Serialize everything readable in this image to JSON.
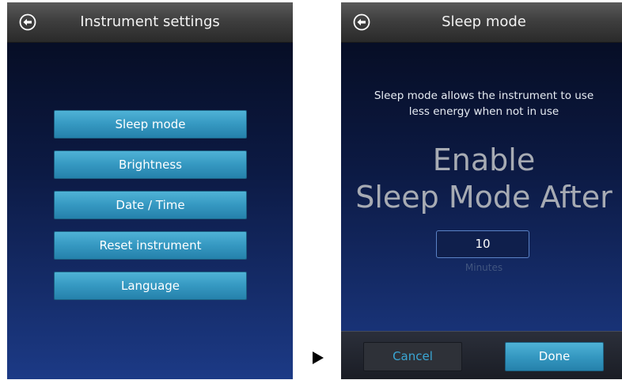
{
  "instrument_settings": {
    "title": "Instrument settings",
    "back_icon": "back-arrow-circle-icon",
    "menu": [
      {
        "label": "Sleep mode"
      },
      {
        "label": "Brightness"
      },
      {
        "label": "Date / Time"
      },
      {
        "label": "Reset instrument"
      },
      {
        "label": "Language"
      }
    ]
  },
  "transition_icon": "right-triangle-arrow-icon",
  "sleep_mode": {
    "title": "Sleep mode",
    "back_icon": "back-arrow-circle-icon",
    "description_line1": "Sleep mode allows the instrument to use",
    "description_line2": "less energy when not in use",
    "headline_line1": "Enable",
    "headline_line2": "Sleep Mode After",
    "value": "10",
    "unit": "Minutes",
    "cancel_label": "Cancel",
    "done_label": "Done"
  },
  "colors": {
    "button_blue": "#3598c1",
    "cancel_text": "#3aa6d4",
    "background_top": "#050a1c",
    "background_bottom": "#1c3a86"
  }
}
